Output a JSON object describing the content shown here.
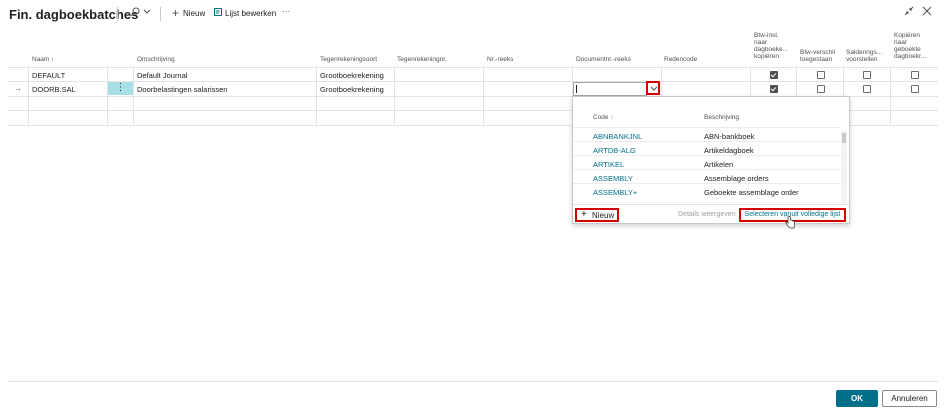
{
  "header": {
    "title": "Fin. dagboekbatches",
    "new_label": "Nieuw",
    "edit_list_label": "Lijst bewerken",
    "more_label": "···"
  },
  "columns": [
    "Naam ↑",
    "Omschrijving",
    "Tegenrekeningsoort",
    "Tegenrekeningnr.",
    "Nr.-reeks",
    "Documentnr.-reeks",
    "Redencode",
    "Btw-inst. naar dagboeke... kopiëren",
    "Btw-verschil toegestaan",
    "Salderings... voorstellen",
    "Kopiëren naar geboekte dagboekr..."
  ],
  "rows": [
    {
      "naam": "DEFAULT",
      "omschrijving": "Default Journal",
      "tegenrekeningsoort": "Grootboekrekening",
      "btw_inst": true,
      "btw_verschil": false,
      "saldering": false,
      "kopieren": false
    },
    {
      "naam": "DOORB.SAL",
      "omschrijving": "Doorbelastingen salarissen",
      "tegenrekeningsoort": "Grootboekrekening",
      "btw_inst": true,
      "btw_verschil": false,
      "saldering": false,
      "kopieren": false
    }
  ],
  "row_more_icon": "⋮",
  "dropdown": {
    "col_code": "Code ↑",
    "col_desc": "Beschrijving",
    "items": [
      {
        "code": "ABNBANKJNL",
        "desc": "ABN-bankboek"
      },
      {
        "code": "ARTDB-ALG",
        "desc": "Artikeldagboek"
      },
      {
        "code": "ARTIKEL",
        "desc": "Artikelen"
      },
      {
        "code": "ASSEMBLY",
        "desc": "Assemblage orders"
      },
      {
        "code": "ASSEMBLY+",
        "desc": "Geboekte assemblage order"
      }
    ],
    "new_label": "Nieuw",
    "details_label": "Details weergeven",
    "select_full_label": "Selecteren vanuit volledige lijst"
  },
  "footer": {
    "ok_label": "OK",
    "cancel_label": "Annuleren"
  },
  "colors": {
    "accent": "#00708a",
    "highlight": "#d40000",
    "selection": "#a8dfe6"
  }
}
